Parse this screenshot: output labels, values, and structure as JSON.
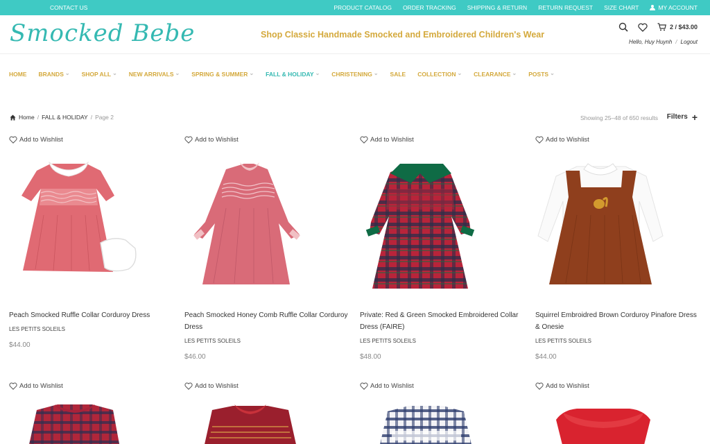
{
  "topbar": {
    "contact": "CONTACT US",
    "links": [
      "PRODUCT CATALOG",
      "ORDER TRACKING",
      "SHIPPING & RETURN",
      "RETURN REQUEST",
      "SIZE CHART"
    ],
    "account": "MY ACCOUNT"
  },
  "header": {
    "logo": "Smocked Bebe",
    "tagline": "Shop Classic Handmade Smocked and Embroidered Children's Wear",
    "cart": "2 / $43.00",
    "hello": "Hello, Huy Huynh",
    "logout": "Logout"
  },
  "nav": [
    {
      "label": "HOME",
      "dd": false
    },
    {
      "label": "BRANDS",
      "dd": true
    },
    {
      "label": "SHOP ALL",
      "dd": true
    },
    {
      "label": "NEW ARRIVALS",
      "dd": true
    },
    {
      "label": "SPRING & SUMMER",
      "dd": true
    },
    {
      "label": "FALL & HOLIDAY",
      "dd": true,
      "active": true
    },
    {
      "label": "CHRISTENING",
      "dd": true
    },
    {
      "label": "SALE",
      "dd": false
    },
    {
      "label": "COLLECTION",
      "dd": true
    },
    {
      "label": "CLEARANCE",
      "dd": true
    },
    {
      "label": "POSTS",
      "dd": true
    }
  ],
  "breadcrumb": {
    "home": "Home",
    "category": "FALL & HOLIDAY",
    "page": "Page 2",
    "sep": "/"
  },
  "results": "Showing 25–48 of 650 results",
  "filters": "Filters",
  "wishlist_label": "Add to Wishlist",
  "products": [
    {
      "name": "Peach Smocked Ruffle Collar Corduroy Dress",
      "brand": "LES PETITS SOLEILS",
      "price": "$44.00"
    },
    {
      "name": "Peach Smocked Honey Comb Ruffle Collar Corduroy Dress",
      "brand": "LES PETITS SOLEILS",
      "price": "$46.00"
    },
    {
      "name": "Private: Red & Green Smocked Embroidered Collar Dress (FAIRE)",
      "brand": "LES PETITS SOLEILS",
      "price": "$48.00"
    },
    {
      "name": "Squirrel Embroidred Brown Corduroy Pinafore Dress & Onesie",
      "brand": "LES PETITS SOLEILS",
      "price": "$44.00"
    }
  ],
  "colors": {
    "teal": "#3fcac4",
    "gold": "#d4a93c"
  }
}
